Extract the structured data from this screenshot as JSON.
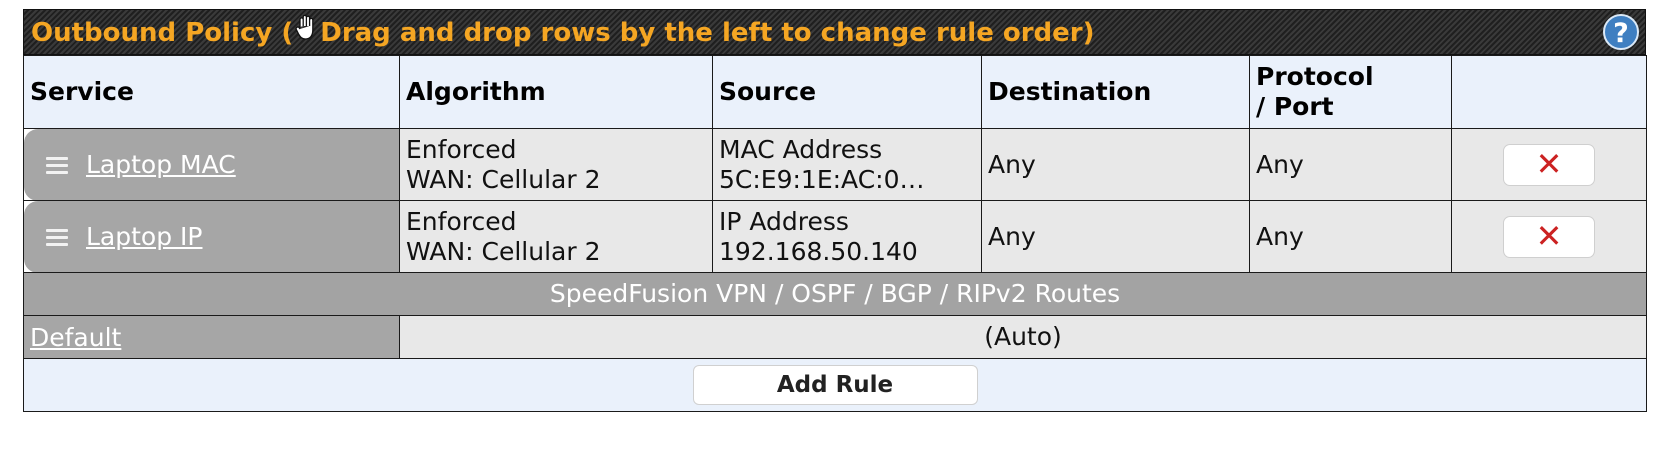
{
  "header": {
    "title_prefix": "Outbound Policy (",
    "title_suffix": "Drag and drop rows by the left to change rule order)",
    "help_label": "?"
  },
  "columns": {
    "service": "Service",
    "algorithm": "Algorithm",
    "source": "Source",
    "destination": "Destination",
    "protocol_line1": "Protocol",
    "protocol_line2": "/ Port"
  },
  "rules": [
    {
      "name": "Laptop MAC",
      "algorithm_line1": "Enforced",
      "algorithm_line2": "WAN: Cellular 2",
      "source_line1": "MAC Address",
      "source_line2": "5C:E9:1E:AC:0…",
      "destination": "Any",
      "protocol": "Any",
      "delete_label": "✕"
    },
    {
      "name": "Laptop IP",
      "algorithm_line1": "Enforced",
      "algorithm_line2": "WAN: Cellular 2",
      "source_line1": "IP Address",
      "source_line2": "192.168.50.140",
      "destination": "Any",
      "protocol": "Any",
      "delete_label": "✕"
    }
  ],
  "separator": "SpeedFusion VPN / OSPF / BGP / RIPv2 Routes",
  "default_rule": {
    "name": "Default",
    "value": "(Auto)"
  },
  "add_rule_label": "Add Rule",
  "colors": {
    "title_text": "#f5a623",
    "header_bg": "#eaf1fb",
    "row_bg": "#e8e8e8",
    "service_bg": "#a6a6a6",
    "delete_icon": "#cc2222",
    "help_bg": "#3f7fc1"
  },
  "icons": [
    "hand-icon",
    "help-icon",
    "drag-handle-icon",
    "delete-icon"
  ]
}
